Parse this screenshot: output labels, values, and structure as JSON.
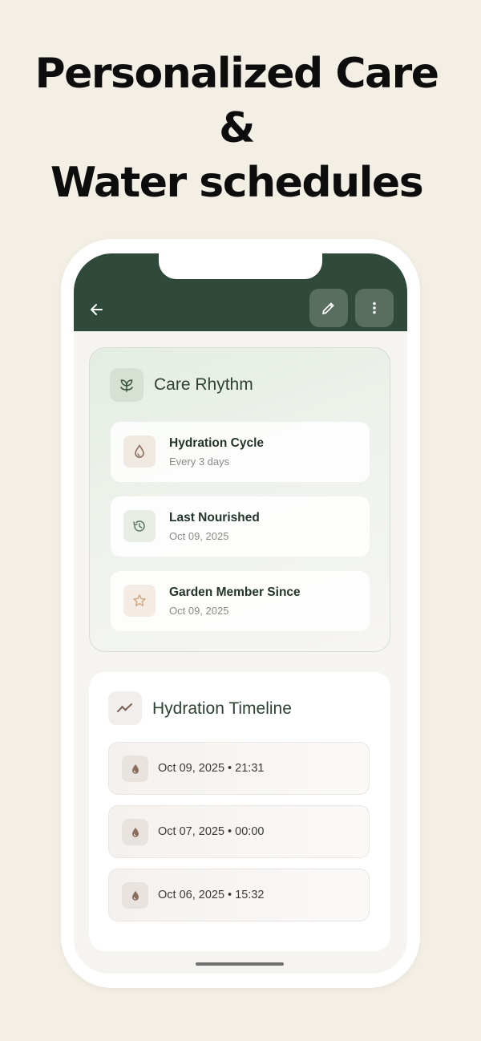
{
  "headline": {
    "line1": "Personalized Care",
    "line2": "&",
    "line3": "Water schedules"
  },
  "appbar": {
    "back_icon": "arrow-left-icon",
    "edit_icon": "pencil-icon",
    "more_icon": "more-vertical-icon",
    "color": "#2f4a3a"
  },
  "care_rhythm": {
    "title": "Care Rhythm",
    "icon": "sprout-icon",
    "items": [
      {
        "title": "Hydration Cycle",
        "subtitle": "Every 3 days",
        "icon": "droplet-icon"
      },
      {
        "title": "Last Nourished",
        "subtitle": "Oct 09, 2025",
        "icon": "history-icon"
      },
      {
        "title": "Garden Member Since",
        "subtitle": "Oct 09, 2025",
        "icon": "star-icon"
      }
    ]
  },
  "hydration_timeline": {
    "title": "Hydration Timeline",
    "icon": "trend-line-icon",
    "entries": [
      {
        "text": "Oct 09, 2025 • 21:31"
      },
      {
        "text": "Oct 07, 2025 • 00:00"
      },
      {
        "text": "Oct 06, 2025 • 15:32"
      }
    ]
  },
  "colors": {
    "background": "#f4efe5",
    "accent_green": "#2f4a3a",
    "drop_brown": "#8b6f5e"
  }
}
